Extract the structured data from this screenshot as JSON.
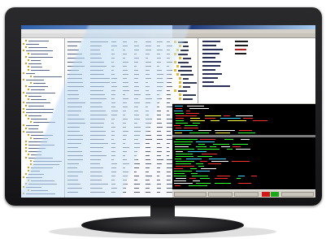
{
  "scene": {
    "device": "desktop-monitor",
    "bezel_color": "#1b1b1d",
    "accent_mark_color": "#e2231a"
  },
  "left_window": {
    "kind": "file-manager-tree-and-grid",
    "titlebar_color": "#2f5fa8",
    "text_color": "#5b6780",
    "folder_icon": "folder-icon"
  },
  "right_window": {
    "kind": "explorer-and-console",
    "titlebar_color": "#0a246a",
    "console_background": "#000000",
    "console_colors": [
      "#ff3030",
      "#30ff30",
      "#ffffff",
      "#ffff40",
      "#40d0ff"
    ],
    "status_indicator_colors": [
      "#d01818",
      "#18a818"
    ],
    "folder_icon": "folder-icon"
  }
}
